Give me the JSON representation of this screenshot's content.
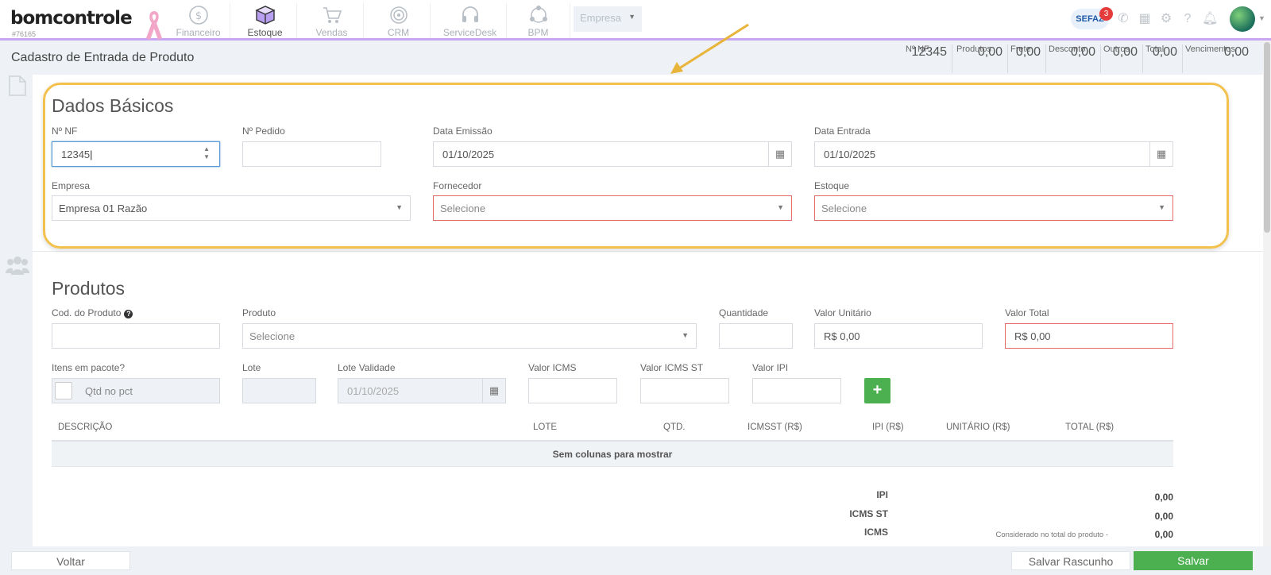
{
  "app": {
    "logo": "bomcontrole",
    "account_id": "#76165"
  },
  "nav": [
    {
      "label": "Financeiro",
      "icon": "dollar-circle-icon"
    },
    {
      "label": "Estoque",
      "icon": "cube-icon"
    },
    {
      "label": "Vendas",
      "icon": "cart-icon"
    },
    {
      "label": "CRM",
      "icon": "target-icon"
    },
    {
      "label": "ServiceDesk",
      "icon": "headset-icon"
    },
    {
      "label": "BPM",
      "icon": "process-icon"
    }
  ],
  "company_select": {
    "value": "Empresa"
  },
  "top_right": {
    "sefaz_label": "SEFAZ",
    "sefaz_count": "3"
  },
  "page": {
    "title": "Cadastro de Entrada de Produto"
  },
  "summary": [
    {
      "label": "Nº NF",
      "value": "12345"
    },
    {
      "label": "Produtos",
      "value": "0,00"
    },
    {
      "label": "Frete",
      "value": "0,00"
    },
    {
      "label": "Desconto",
      "value": "0,00"
    },
    {
      "label": "Outros",
      "value": "0,00"
    },
    {
      "label": "Total",
      "value": "0,00"
    },
    {
      "label": "Vencimentos",
      "value": "0,00"
    }
  ],
  "basic": {
    "title": "Dados Básicos",
    "nf_label": "Nº NF",
    "nf_value": "12345",
    "pedido_label": "Nº Pedido",
    "pedido_value": "",
    "emissao_label": "Data Emissão",
    "emissao_value": "01/10/2025",
    "entrada_label": "Data Entrada",
    "entrada_value": "01/10/2025",
    "empresa_label": "Empresa",
    "empresa_value": "Empresa 01 Razão",
    "fornecedor_label": "Fornecedor",
    "fornecedor_placeholder": "Selecione",
    "estoque_label": "Estoque",
    "estoque_placeholder": "Selecione"
  },
  "products": {
    "title": "Produtos",
    "cod_label": "Cod. do Produto",
    "produto_label": "Produto",
    "produto_placeholder": "Selecione",
    "qtd_label": "Quantidade",
    "unit_label": "Valor Unitário",
    "unit_value": "R$ 0,00",
    "total_label": "Valor Total",
    "total_value": "R$ 0,00",
    "pacote_label": "Itens em pacote?",
    "pacote_placeholder": "Qtd no pct",
    "lote_label": "Lote",
    "validade_label": "Lote Validade",
    "validade_value": "01/10/2025",
    "icms_label": "Valor ICMS",
    "icmsst_label": "Valor ICMS ST",
    "ipi_label": "Valor IPI",
    "add_label": "+"
  },
  "table": {
    "columns": [
      "DESCRIÇÃO",
      "LOTE",
      "QTD.",
      "ICMSST (R$)",
      "IPI (R$)",
      "UNITÁRIO (R$)",
      "TOTAL (R$)"
    ],
    "empty": "Sem colunas para mostrar"
  },
  "totals": {
    "ipi_label": "IPI",
    "ipi_value": "0,00",
    "icmsst_label": "ICMS ST",
    "icmsst_value": "0,00",
    "icms_label": "ICMS",
    "icms_note": "Considerado no total do produto -",
    "icms_value": "0,00"
  },
  "footer": {
    "back": "Voltar",
    "draft": "Salvar Rascunho",
    "save": "Salvar"
  }
}
